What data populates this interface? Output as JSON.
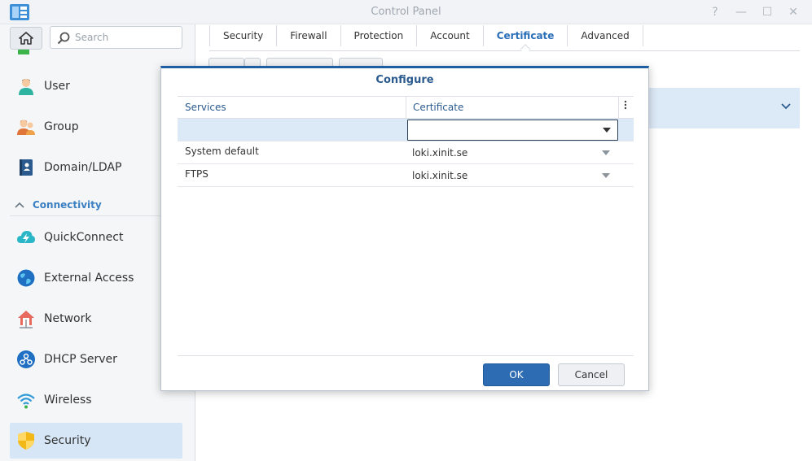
{
  "window": {
    "title": "Control Panel",
    "controls": [
      {
        "name": "help-icon",
        "glyph": "?"
      },
      {
        "name": "minimize-icon",
        "glyph": "—"
      },
      {
        "name": "maximize-icon",
        "glyph": "☐"
      },
      {
        "name": "close-icon",
        "glyph": "✕"
      }
    ]
  },
  "sidebar": {
    "search": {
      "placeholder": "Search",
      "value": ""
    },
    "items_top": [
      {
        "label": "User",
        "icon": "user-icon"
      },
      {
        "label": "Group",
        "icon": "group-icon"
      },
      {
        "label": "Domain/LDAP",
        "icon": "domain-ldap-icon"
      }
    ],
    "section": {
      "label": "Connectivity",
      "icon": "chevron-up-icon"
    },
    "items_connectivity": [
      {
        "label": "QuickConnect",
        "icon": "quickconnect-icon"
      },
      {
        "label": "External Access",
        "icon": "external-access-icon"
      },
      {
        "label": "Network",
        "icon": "network-icon"
      },
      {
        "label": "DHCP Server",
        "icon": "dhcp-server-icon"
      },
      {
        "label": "Wireless",
        "icon": "wireless-icon"
      },
      {
        "label": "Security",
        "icon": "security-shield-icon",
        "selected": true
      }
    ]
  },
  "main": {
    "tabs": [
      {
        "label": "Security"
      },
      {
        "label": "Firewall"
      },
      {
        "label": "Protection"
      },
      {
        "label": "Account"
      },
      {
        "label": "Certificate",
        "active": true
      },
      {
        "label": "Advanced"
      }
    ]
  },
  "dialog": {
    "title": "Configure",
    "columns": {
      "services": "Services",
      "certificate": "Certificate"
    },
    "rows": [
      {
        "service": "System default",
        "certificate": "loki.xinit.se"
      },
      {
        "service": "FTPS",
        "certificate": "loki.xinit.se"
      }
    ],
    "editing_value": "",
    "ok_label": "OK",
    "cancel_label": "Cancel"
  },
  "colors": {
    "accent": "#2d6bb3",
    "selection": "#d6e6f6",
    "section_label": "#3a7fc1"
  }
}
